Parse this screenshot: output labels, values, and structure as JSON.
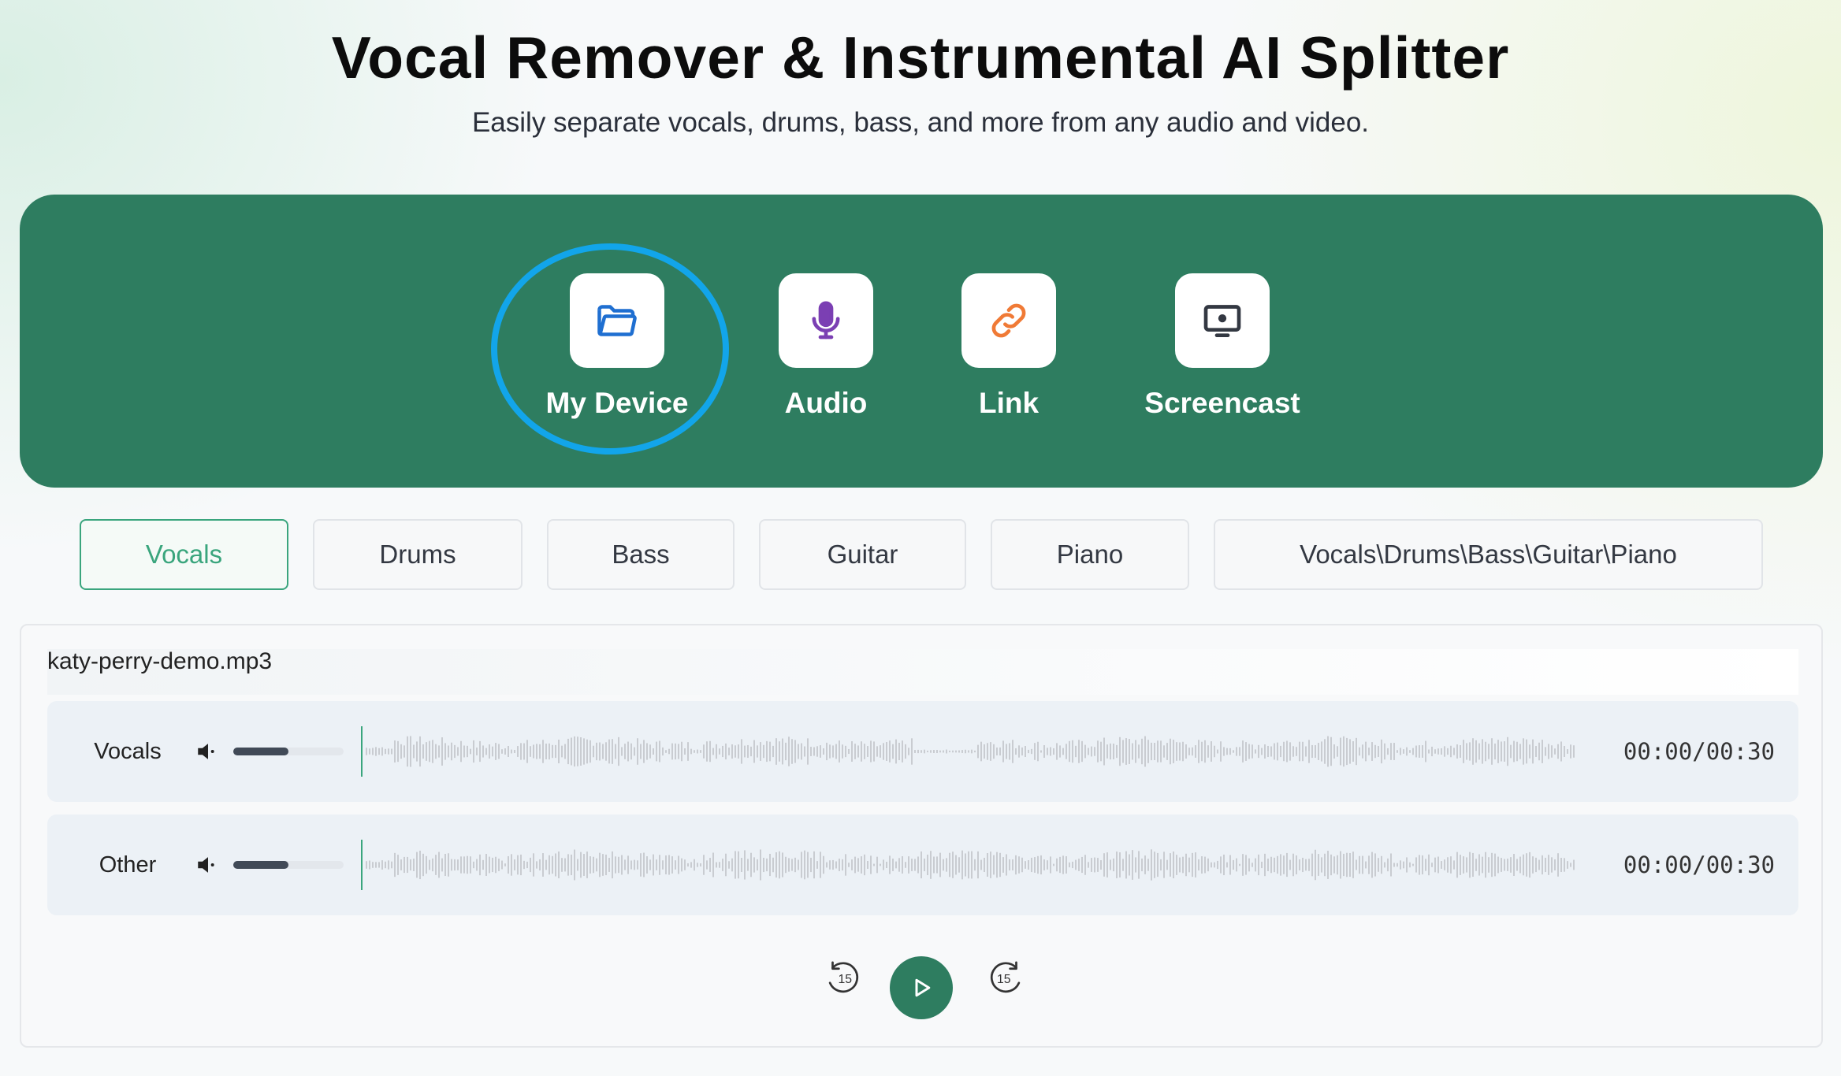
{
  "header": {
    "title": "Vocal Remover & Instrumental AI Splitter",
    "subtitle": "Easily separate vocals, drums, bass, and more from any audio and video."
  },
  "sources": [
    {
      "label": "My Device",
      "icon": "folder-icon",
      "color": "#1f6fd1",
      "highlighted": true
    },
    {
      "label": "Audio",
      "icon": "microphone-icon",
      "color": "#7b3fb3"
    },
    {
      "label": "Link",
      "icon": "link-icon",
      "color": "#f07a36"
    },
    {
      "label": "Screencast",
      "icon": "screen-icon",
      "color": "#333842"
    }
  ],
  "stems": {
    "active": "Vocals",
    "tabs": [
      "Vocals",
      "Drums",
      "Bass",
      "Guitar",
      "Piano",
      "Vocals\\Drums\\Bass\\Guitar\\Piano"
    ]
  },
  "player": {
    "filename": "katy-perry-demo.mp3",
    "tracks": [
      {
        "name": "Vocals",
        "volume": 0.5,
        "current": "00:00",
        "separator": "/",
        "duration": "00:30"
      },
      {
        "name": "Other",
        "volume": 0.5,
        "current": "00:00",
        "separator": "/",
        "duration": "00:30"
      }
    ],
    "rewind_label": "15",
    "forward_label": "15"
  },
  "colors": {
    "brand_green": "#2e7d60",
    "accent_green": "#3aa57d",
    "highlight_blue": "#12a5ea",
    "waveform": "#c9ccd1"
  }
}
